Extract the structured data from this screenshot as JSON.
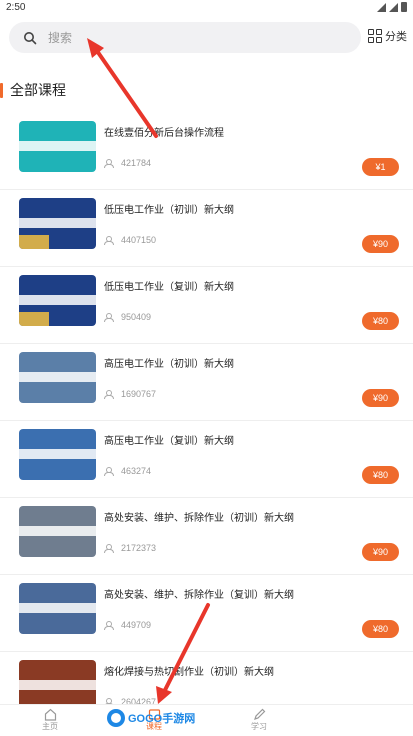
{
  "status": {
    "time": "2:50"
  },
  "search": {
    "placeholder": "搜索"
  },
  "header": {
    "category_label": "分类"
  },
  "section": {
    "title": "全部课程"
  },
  "courses": [
    {
      "title": "在线壹佰分新后台操作流程",
      "count": "421784",
      "price": "¥1",
      "thumb_color": "#1fb3b7"
    },
    {
      "title": "低压电工作业（初训）新大纲",
      "count": "4407150",
      "price": "¥90",
      "thumb_color": "#1e3f86"
    },
    {
      "title": "低压电工作业（复训）新大纲",
      "count": "950409",
      "price": "¥80",
      "thumb_color": "#1e3f86"
    },
    {
      "title": "高压电工作业（初训）新大纲",
      "count": "1690767",
      "price": "¥90",
      "thumb_color": "#5b7fa8"
    },
    {
      "title": "高压电工作业（复训）新大纲",
      "count": "463274",
      "price": "¥80",
      "thumb_color": "#3b6fb0"
    },
    {
      "title": "高处安装、维护、拆除作业（初训）新大纲",
      "count": "2172373",
      "price": "¥90",
      "thumb_color": "#6f7d8f"
    },
    {
      "title": "高处安装、维护、拆除作业（复训）新大纲",
      "count": "449709",
      "price": "¥80",
      "thumb_color": "#4a6a9a"
    },
    {
      "title": "熔化焊接与热切割作业（初训）新大纲",
      "count": "2604267",
      "price": "",
      "thumb_color": "#8a3a24"
    }
  ],
  "tabbar": {
    "home_label": "主页",
    "course_label": "课程",
    "study_label": "学习"
  },
  "watermark": {
    "text": "GOGO手游网"
  },
  "colors": {
    "accent": "#ef6a2c",
    "annotation_red": "#e8362b"
  }
}
